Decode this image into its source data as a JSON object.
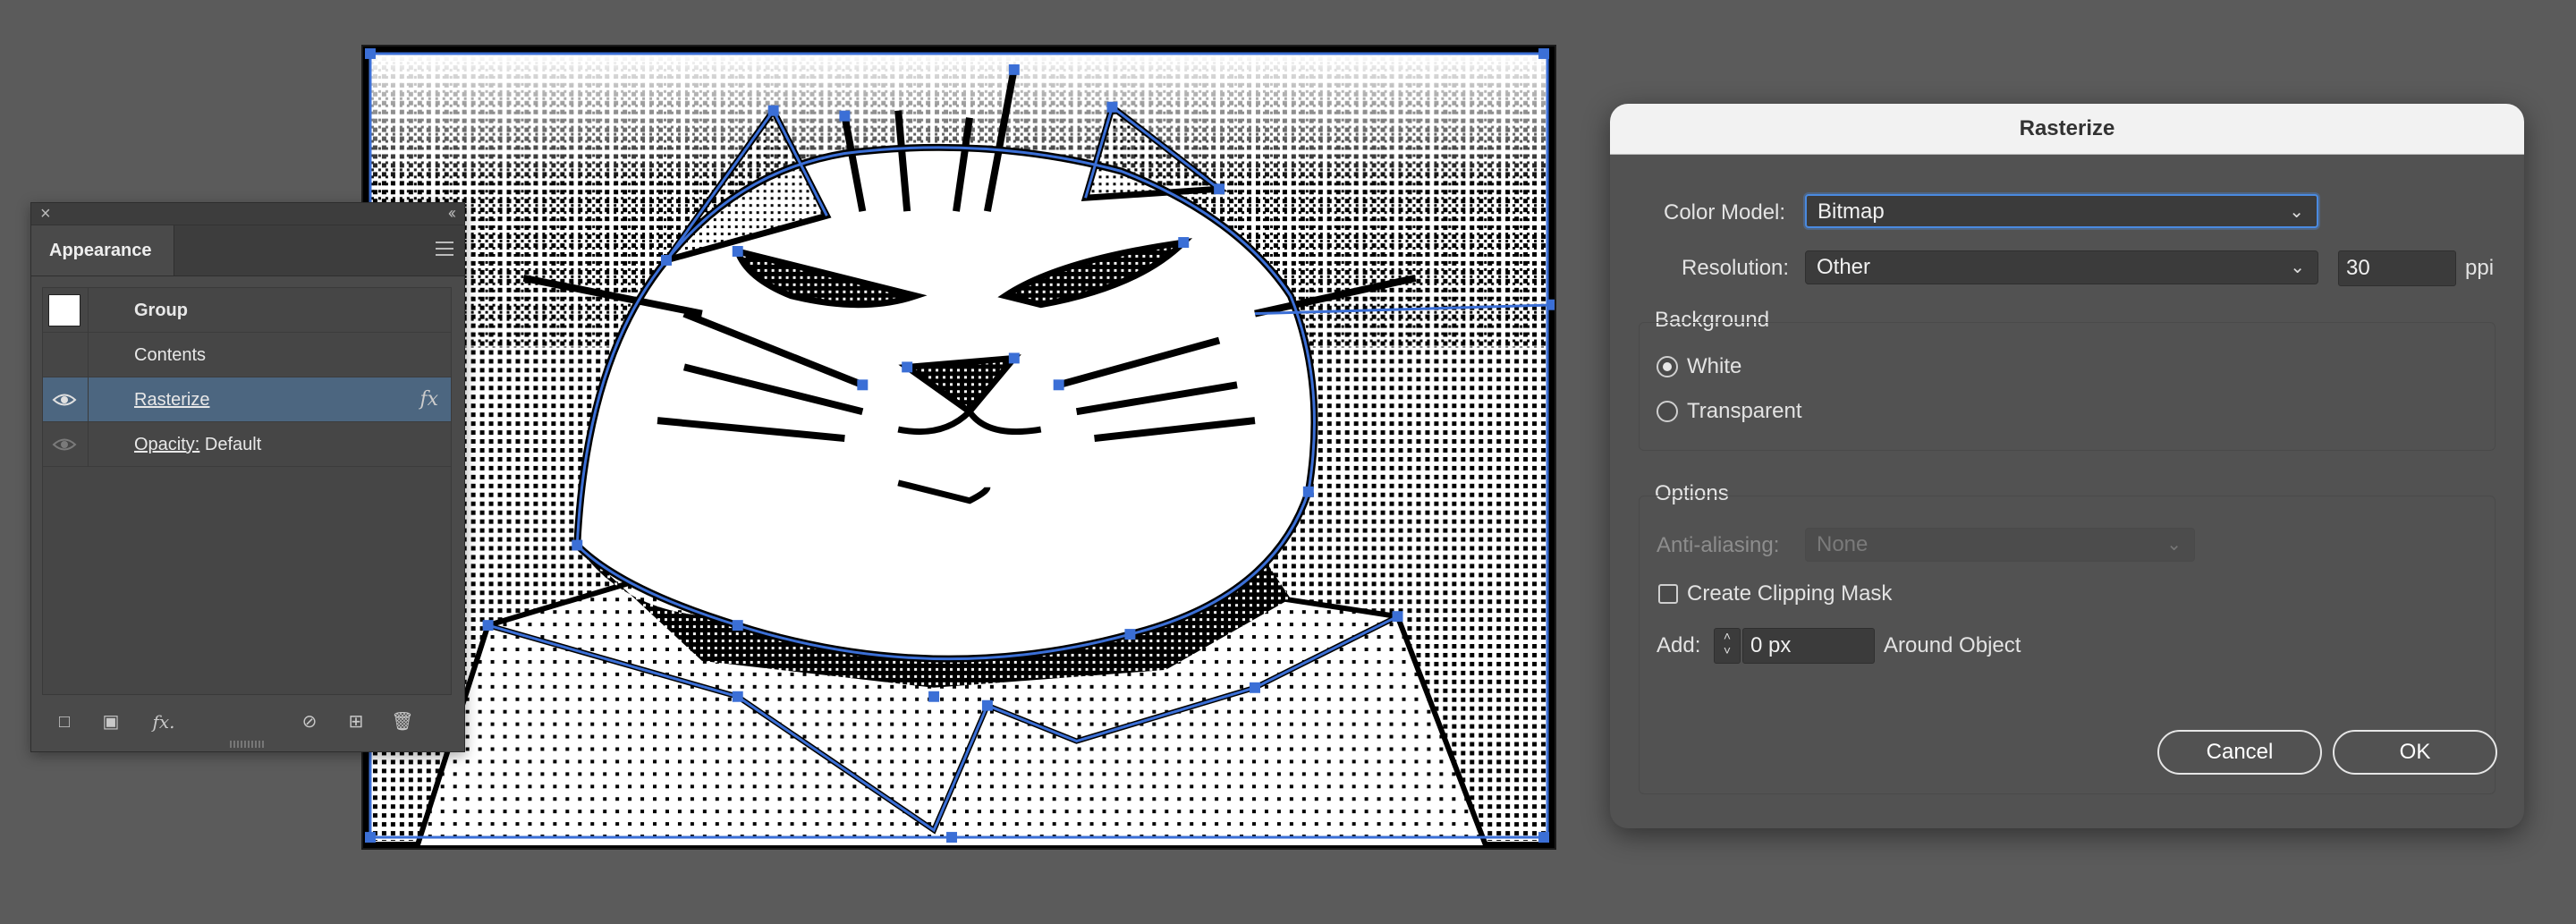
{
  "appearance_panel": {
    "tab_label": "Appearance",
    "rows": [
      {
        "label": "Group"
      },
      {
        "label": "Contents"
      },
      {
        "label": "Rasterize",
        "fx": "fx"
      },
      {
        "label_key": "Opacity:",
        "label_value": "Default"
      }
    ],
    "footer_fx": "fx."
  },
  "dialog": {
    "title": "Rasterize",
    "color_model_label": "Color Model:",
    "color_model_value": "Bitmap",
    "resolution_label": "Resolution:",
    "resolution_value": "Other",
    "resolution_number": "30",
    "resolution_unit": "ppi",
    "background_heading": "Background",
    "background_options": [
      "White",
      "Transparent"
    ],
    "background_selected": "White",
    "options_heading": "Options",
    "anti_aliasing_label": "Anti-aliasing:",
    "anti_aliasing_value": "None",
    "clipping_mask_label": "Create Clipping Mask",
    "clipping_mask_checked": false,
    "add_label": "Add:",
    "add_value": "0 px",
    "around_object_label": "Around Object",
    "cancel_label": "Cancel",
    "ok_label": "OK"
  },
  "colors": {
    "canvas_bg": "#5b5b5b",
    "selection_blue": "#3b6fd6",
    "row_selected": "#4c6680"
  },
  "icons": [
    "close-icon",
    "collapse-icon",
    "panel-menu-icon",
    "eye-icon",
    "fx-icon",
    "add-new-stroke-icon",
    "add-new-fill-icon",
    "clear-appearance-icon",
    "duplicate-item-icon",
    "trash-icon",
    "chevron-down-icon",
    "stepper-icon"
  ]
}
